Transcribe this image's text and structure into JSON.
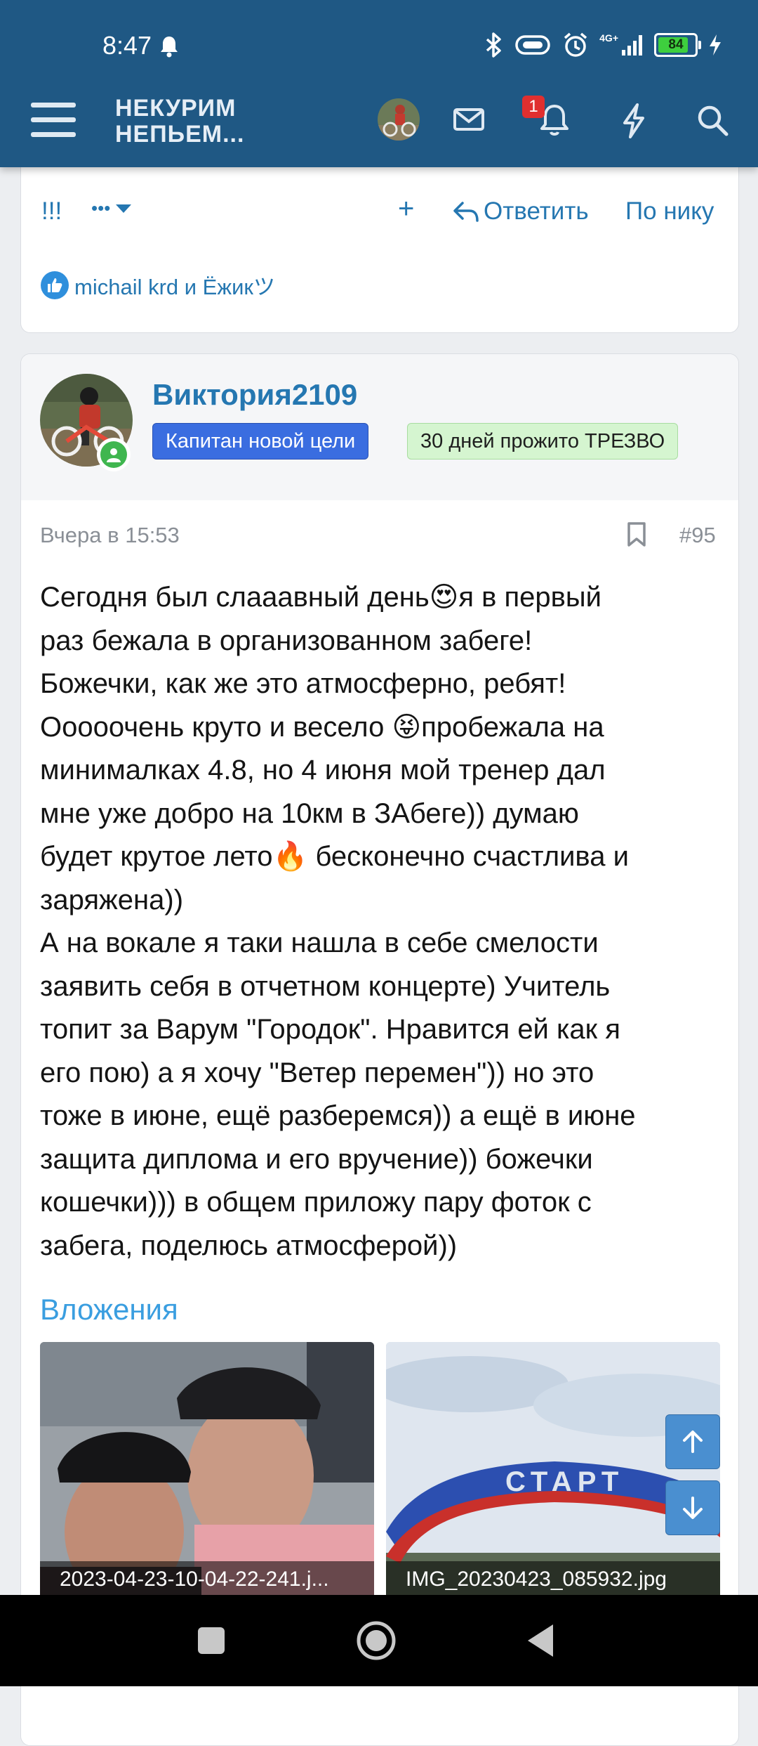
{
  "status_bar": {
    "time": "8:47",
    "network": "4G+",
    "battery": "84",
    "battery_fraction": 0.84
  },
  "app_bar": {
    "logo_line1": "НЕКУРИМ",
    "logo_line2": "НЕПЬЕМ...",
    "notification_count": "1",
    "icons": [
      "menu-icon",
      "avatar",
      "mail-icon",
      "bell-icon",
      "lightning-icon",
      "search-icon"
    ]
  },
  "prev_post": {
    "actions": {
      "exclaim": "!!!",
      "more": "•••",
      "plus": "+",
      "reply": "Ответить",
      "by_nick": "По нику"
    },
    "reactions_text": "michail krd и Ёжикツ"
  },
  "post": {
    "username": "Виктория2109",
    "banners": [
      "Капитан новой цели",
      "30 дней прожито ТРЕЗВО"
    ],
    "date": "Вчера в 15:53",
    "number": "#95",
    "text": "Сегодня был слааавный день😍я в первый\nраз бежала в организованном забеге!\nБожечки, как же это атмосферно, ребят!\nОоооочень круто и весело 😝пробежала на\nминималках 4.8, но 4 июня мой тренер дал\nмне уже добро на 10км в ЗАбеге)) думаю\nбудет крутое лето🔥 бесконечно счастлива и\nзаряжена))\nА на вокале я таки нашла в себе смелости\nзаявить себя в отчетном концерте) Учитель\nтопит за Варум \"Городок\". Нравится ей как я\nего пою) а я хочу \"Ветер перемен\")) но это\nтоже в июне, ещё разберемся)) а ещё в июне\nзащита диплома и его вручение)) божечки\nкошечки))) в общем приложу пару фоток с\nзабега, поделюсь атмосферой))",
    "attachments_title": "Вложения",
    "attachments": [
      {
        "name": "2023-04-23-10-04-22-241.j..."
      },
      {
        "name": "IMG_20230423_085932.jpg",
        "overlay_text": "СТАРТ"
      }
    ]
  },
  "colors": {
    "header_bg": "#1f5884",
    "link": "#2577b1",
    "banner_blue": "#3a6de0",
    "banner_green_bg": "#d5f5d0",
    "scroll_btn": "#4a8fd0"
  }
}
